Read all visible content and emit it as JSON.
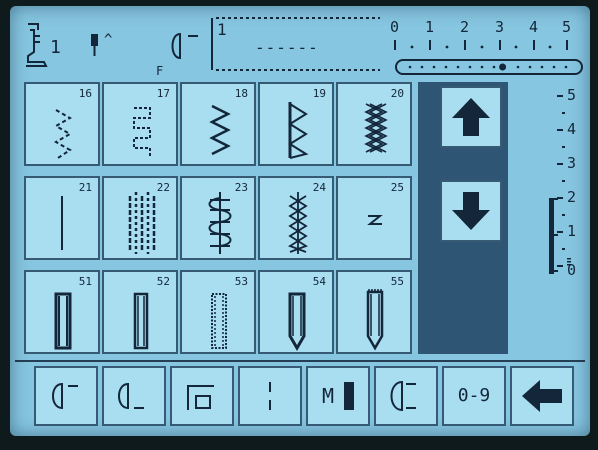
{
  "header": {
    "presser_foot_number": "1",
    "needle_indicator": "^",
    "memory_label": "F",
    "pattern_index": "1",
    "pattern_placeholder": "------",
    "width_scale_ticks": [
      "0",
      "1",
      "2",
      "3",
      "4",
      "5"
    ],
    "width_position_fraction": 0.58
  },
  "stitch_grid": {
    "rows": [
      [
        {
          "number": "16",
          "pattern": "triple-zigzag-icon"
        },
        {
          "number": "17",
          "pattern": "serpentine-icon"
        },
        {
          "number": "18",
          "pattern": "zigzag-icon"
        },
        {
          "number": "19",
          "pattern": "blind-hem-icon"
        },
        {
          "number": "20",
          "pattern": "honeycomb-icon"
        }
      ],
      [
        {
          "number": "21",
          "pattern": "straight-stitch-icon"
        },
        {
          "number": "22",
          "pattern": "ladder-stitch-icon"
        },
        {
          "number": "23",
          "pattern": "smocking-icon"
        },
        {
          "number": "24",
          "pattern": "cross-stitch-icon"
        },
        {
          "number": "25",
          "pattern": "bartack-icon"
        }
      ],
      [
        {
          "number": "51",
          "pattern": "buttonhole-standard-icon"
        },
        {
          "number": "52",
          "pattern": "buttonhole-narrow-icon"
        },
        {
          "number": "53",
          "pattern": "buttonhole-stretch-icon"
        },
        {
          "number": "54",
          "pattern": "buttonhole-rounded-icon"
        },
        {
          "number": "55",
          "pattern": "buttonhole-keyhole-icon"
        }
      ]
    ]
  },
  "navigation": {
    "scroll_up": "up-arrow-icon",
    "scroll_down": "down-arrow-icon"
  },
  "length_scale": {
    "labels": [
      "5",
      "4",
      "3",
      "2",
      "1",
      "0"
    ],
    "bar_top_value": 2
  },
  "bottom_bar": {
    "buttons": [
      {
        "name": "needle-stop-up-button",
        "icon": "needle-stop-up-icon"
      },
      {
        "name": "needle-stop-down-button",
        "icon": "needle-stop-down-icon"
      },
      {
        "name": "pattern-start-button",
        "icon": "pattern-start-icon"
      },
      {
        "name": "balance-button",
        "icon": "balance-icon"
      },
      {
        "name": "memory-button",
        "icon": "memory-icon",
        "label": "M"
      },
      {
        "name": "tie-off-button",
        "icon": "tie-off-icon"
      },
      {
        "name": "number-entry-button",
        "label": "0-9"
      },
      {
        "name": "back-button",
        "icon": "left-arrow-icon"
      }
    ]
  },
  "colors": {
    "screen": "#86c6e0",
    "cell": "#a9ddf0",
    "ink": "#13263a",
    "panel": "#2f5574"
  }
}
